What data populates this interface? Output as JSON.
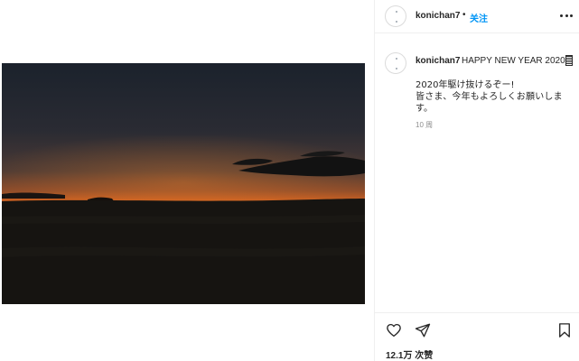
{
  "post": {
    "username": "konichan7",
    "separator": "•",
    "follow_label": "关注",
    "caption_title": "HAPPY NEW YEAR 2020",
    "caption_line1": "2020年駆け抜けるぞー!",
    "caption_line2": "皆さま、今年もよろしくお願いしま",
    "caption_line3": "す。",
    "time_ago": "10 周",
    "likes_count": "12.1万",
    "likes_label": "次赞"
  },
  "icons": {
    "more": "more-options-icon",
    "like": "heart-icon",
    "share": "paper-plane-icon",
    "save": "bookmark-icon",
    "emoji": "emoji-icon"
  },
  "colors": {
    "link": "#0095f6",
    "text": "#262626",
    "muted": "#8e8e8e",
    "border": "#efefef"
  }
}
